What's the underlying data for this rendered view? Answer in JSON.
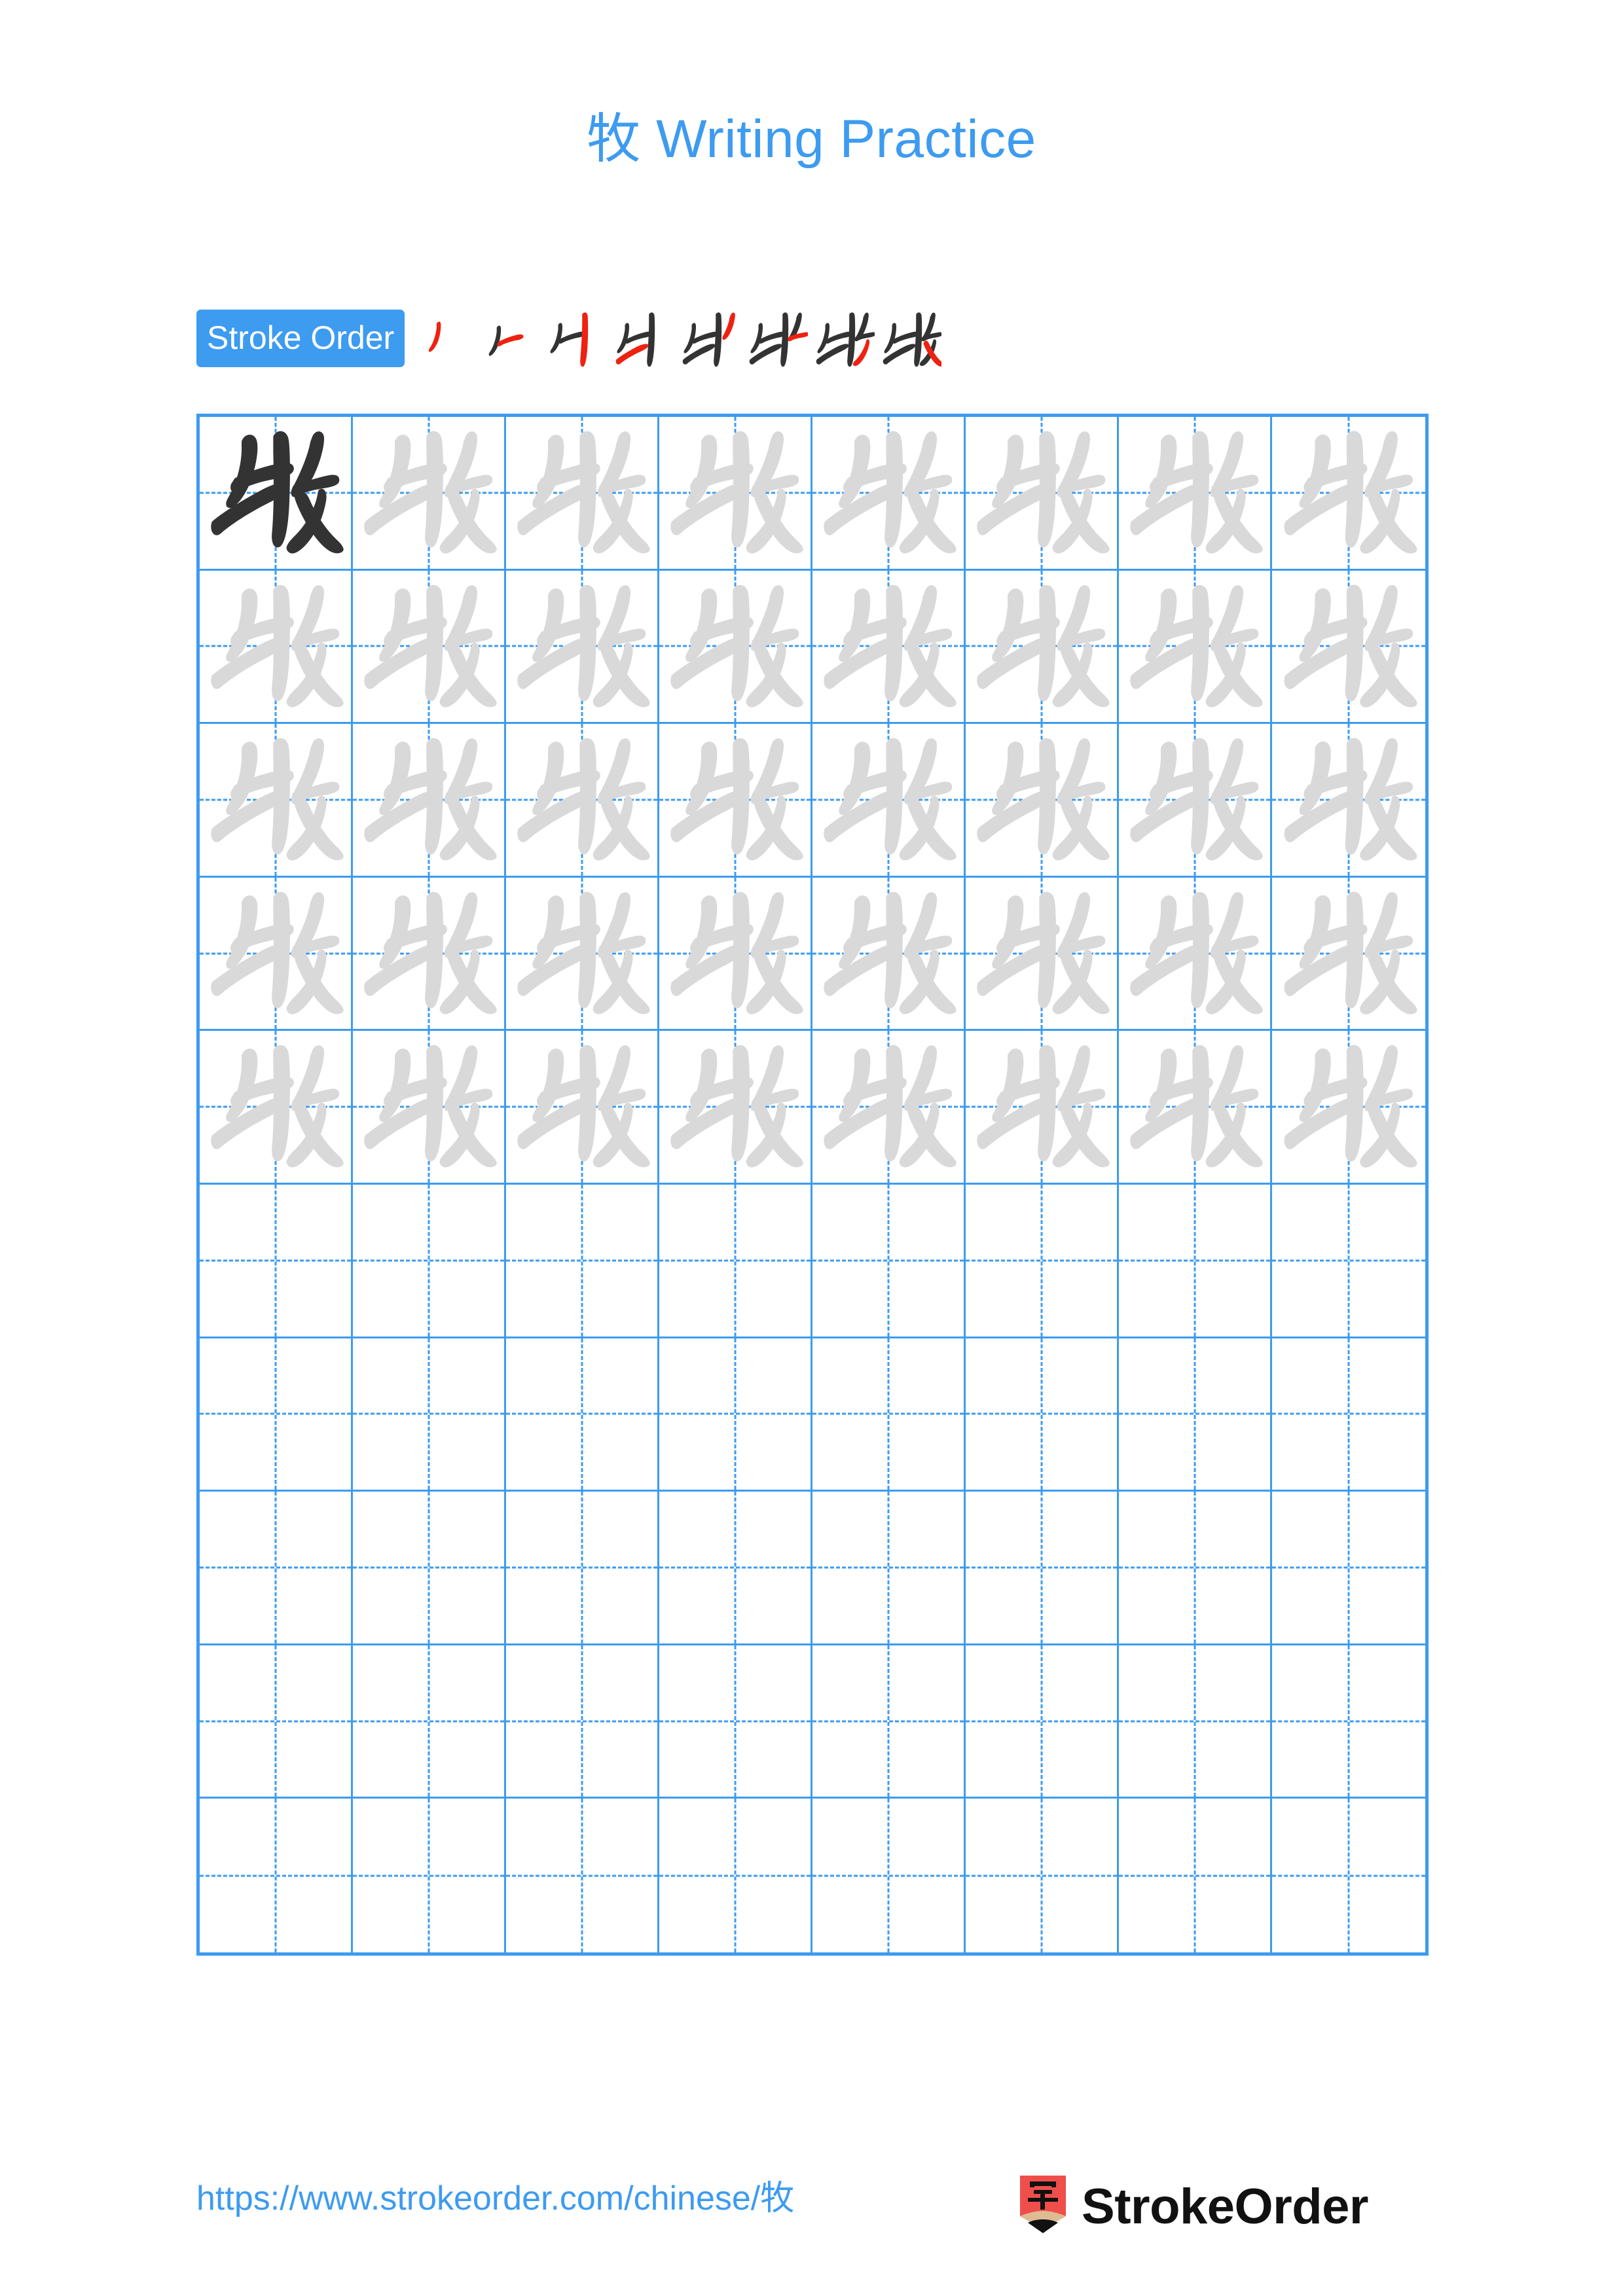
{
  "character": "牧",
  "title": "牧 Writing Practice",
  "colors": {
    "accent_blue": "#3d9bf0",
    "grid_blue": "#3d9bf0",
    "trace_gray": "#d9d9d9",
    "ink_black": "#333333",
    "stroke_red": "#ee2211",
    "logo_red": "#f04e4a",
    "logo_wood": "#ddbc92",
    "page_background": "#ffffff"
  },
  "stroke_order": {
    "badge_label": "Stroke Order",
    "total_strokes": 8,
    "steps": [
      {
        "index": 1,
        "completed_strokes": 0,
        "new_stroke": 1
      },
      {
        "index": 2,
        "completed_strokes": 1,
        "new_stroke": 2
      },
      {
        "index": 3,
        "completed_strokes": 2,
        "new_stroke": 3
      },
      {
        "index": 4,
        "completed_strokes": 3,
        "new_stroke": 4
      },
      {
        "index": 5,
        "completed_strokes": 4,
        "new_stroke": 5
      },
      {
        "index": 6,
        "completed_strokes": 5,
        "new_stroke": 6
      },
      {
        "index": 7,
        "completed_strokes": 6,
        "new_stroke": 7
      },
      {
        "index": 8,
        "completed_strokes": 7,
        "new_stroke": 8
      }
    ]
  },
  "practice_grid": {
    "columns": 8,
    "rows": 10,
    "filled_rows": 5,
    "empty_rows": 5,
    "first_cell_style": "solid-black",
    "traced_cell_style": "light-gray",
    "guide_lines": "dashed-cross"
  },
  "footer": {
    "url": "https://www.strokeorder.com/chinese/牧",
    "brand_name": "StrokeOrder",
    "brand_mark_character": "字"
  }
}
